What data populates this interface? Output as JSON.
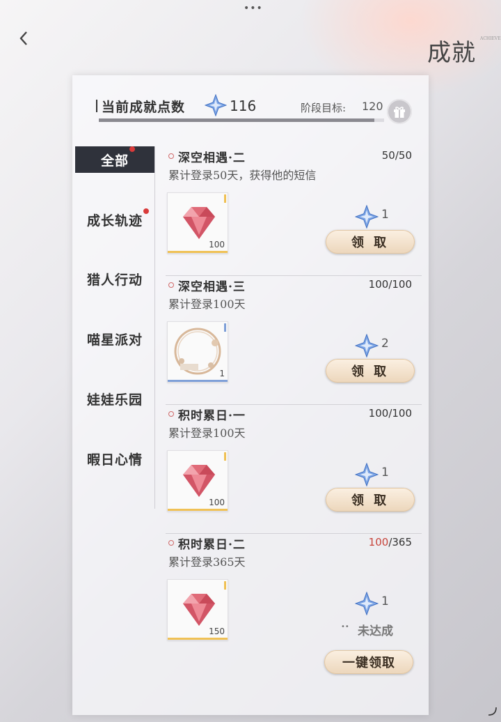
{
  "header": {
    "menu_dots": "•••",
    "page_title": "成就",
    "page_title_sub": "ACHIEVEMENT"
  },
  "summary": {
    "label": "当前成就点数",
    "points": "116",
    "target_label": "阶段目标:",
    "target_value": "120",
    "progress_fraction": 0.967
  },
  "sidebar": {
    "items": [
      {
        "label": "全部",
        "active": true,
        "badge": true
      },
      {
        "label": "成长轨迹",
        "active": false,
        "badge": true
      },
      {
        "label": "猎人行动",
        "active": false,
        "badge": false
      },
      {
        "label": "喵星派对",
        "active": false,
        "badge": false
      },
      {
        "label": "娃娃乐园",
        "active": false,
        "badge": false
      },
      {
        "label": "暇日心情",
        "active": false,
        "badge": false
      }
    ]
  },
  "achievements": [
    {
      "title": "深空相遇·二",
      "progress_current": "50",
      "progress_total": "/50",
      "incomplete": false,
      "desc": "累计登录50天，获得他的短信",
      "item_icon": "diamond-icon",
      "item_qty": "100",
      "reward_points": "1",
      "action": "领 取"
    },
    {
      "title": "深空相遇·三",
      "progress_current": "100",
      "progress_total": "/100",
      "incomplete": false,
      "desc": "累计登录100天",
      "item_icon": "frame-icon",
      "item_qty": "1",
      "reward_points": "2",
      "action": "领 取"
    },
    {
      "title": "积时累日·一",
      "progress_current": "100",
      "progress_total": "/100",
      "incomplete": false,
      "desc": "累计登录100天",
      "item_icon": "diamond-icon",
      "item_qty": "100",
      "reward_points": "1",
      "action": "领 取"
    },
    {
      "title": "积时累日·二",
      "progress_current": "100",
      "progress_total": "/365",
      "incomplete": true,
      "desc": "累计登录365天",
      "item_icon": "diamond-icon",
      "item_qty": "150",
      "reward_points": "1",
      "action": "未达成"
    }
  ],
  "footer": {
    "claim_all": "一键领取"
  },
  "colors": {
    "accent_red": "#c7443b",
    "active_tab": "#2f323b",
    "button_gold": "#ecd6bb"
  }
}
